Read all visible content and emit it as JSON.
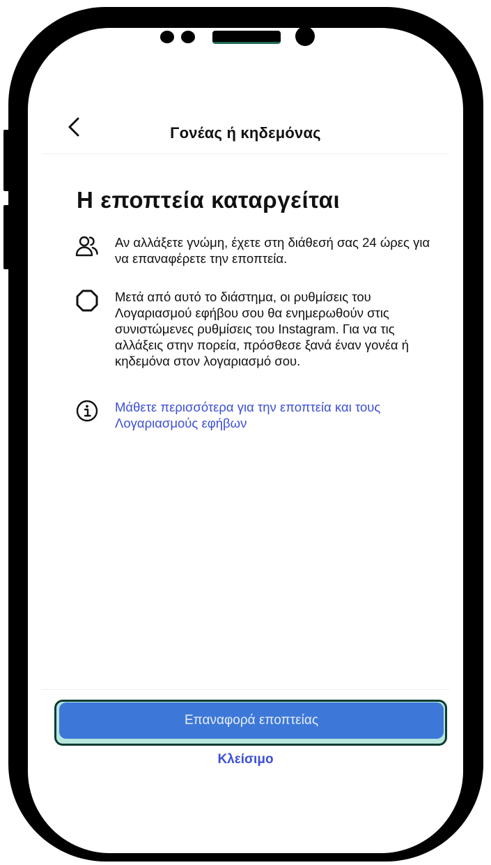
{
  "header": {
    "title": "Γονέας ή κηδεμόνας",
    "back_icon": "chevron-left-icon"
  },
  "main": {
    "title": "Η εποπτεία καταργείται",
    "items": [
      {
        "icon": "people-icon",
        "text": "Αν αλλάξετε γνώμη, έχετε στη διάθεσή σας 24 ώρες για να επαναφέρετε την εποπτεία."
      },
      {
        "icon": "settings-gear-icon",
        "text": "Μετά από αυτό το διάστημα, οι ρυθμίσεις του Λογαριασμού εφήβου σου θα ενημερωθούν στις συνιστώμενες ρυθμίσεις του Instagram. Για να τις αλλάξεις στην πορεία, πρόσθεσε ξανά έναν γονέα ή κηδεμόνα στον λογαριασμό σου."
      },
      {
        "icon": "info-icon",
        "text": "Μάθετε περισσότερα για την εποπτεία και τους Λογαριασμούς εφήβων"
      }
    ]
  },
  "footer": {
    "primary_button": "Επαναφορά εποπτείας",
    "close_link": "Κλείσιμο"
  },
  "colors": {
    "accent_button": "#3d78d8",
    "link": "#3d4fd6",
    "highlight_frame": "#b7e6dd"
  }
}
